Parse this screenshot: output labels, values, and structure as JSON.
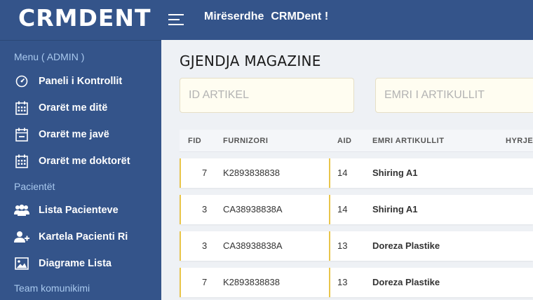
{
  "header": {
    "logo": "CRMDENT",
    "greeting": "Mirëserdhe",
    "brand": "CRMDent !"
  },
  "sidebar": {
    "sections": [
      {
        "label": "Menu ( ADMIN )"
      },
      {
        "label": "Pacientët"
      },
      {
        "label": "Team komunikimi"
      }
    ],
    "items": [
      {
        "label": "Paneli i Kontrollit",
        "icon": "dashboard-icon"
      },
      {
        "label": "Orarët me ditë",
        "icon": "calendar-icon"
      },
      {
        "label": "Orarët me javë",
        "icon": "calendar-week-icon"
      },
      {
        "label": "Orarët me doktorët",
        "icon": "calendar-icon"
      },
      {
        "label": "Lista Pacienteve",
        "icon": "users-icon"
      },
      {
        "label": "Kartela Pacienti Ri",
        "icon": "user-plus-icon"
      },
      {
        "label": "Diagrame Lista",
        "icon": "image-icon"
      }
    ]
  },
  "main": {
    "title": "GJENDJA MAGAZINE",
    "filters": {
      "id_placeholder": "ID ARTIKEL",
      "name_placeholder": "EMRI I ARTIKULLIT"
    },
    "table": {
      "columns": [
        "FID",
        "FURNIZORI",
        "AID",
        "EMRI ARTIKULLIT",
        "HYRJE"
      ],
      "rows": [
        {
          "fid": "7",
          "furnizori": "K2893838838",
          "aid": "14",
          "emri": "Shiring A1"
        },
        {
          "fid": "3",
          "furnizori": "CA38938838A",
          "aid": "14",
          "emri": "Shiring A1"
        },
        {
          "fid": "3",
          "furnizori": "CA38938838A",
          "aid": "13",
          "emri": "Doreza Plastike"
        },
        {
          "fid": "7",
          "furnizori": "K2893838838",
          "aid": "13",
          "emri": "Doreza Plastike"
        }
      ]
    }
  },
  "colors": {
    "primary": "#34548a",
    "section_label": "#a9c9ee",
    "row_accent": "#e8c54a",
    "filter_bg": "#fffdf1"
  }
}
